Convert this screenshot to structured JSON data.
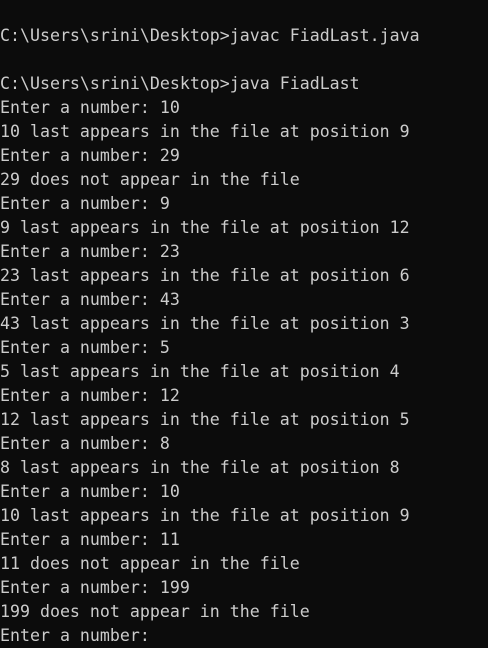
{
  "terminal": {
    "lines": [
      "",
      "C:\\Users\\srini\\Desktop>javac FiadLast.java",
      "",
      "C:\\Users\\srini\\Desktop>java FiadLast",
      "Enter a number: 10",
      "10 last appears in the file at position 9",
      "Enter a number: 29",
      "29 does not appear in the file",
      "Enter a number: 9",
      "9 last appears in the file at position 12",
      "Enter a number: 23",
      "23 last appears in the file at position 6",
      "Enter a number: 43",
      "43 last appears in the file at position 3",
      "Enter a number: 5",
      "5 last appears in the file at position 4",
      "Enter a number: 12",
      "12 last appears in the file at position 5",
      "Enter a number: 8",
      "8 last appears in the file at position 8",
      "Enter a number: 10",
      "10 last appears in the file at position 9",
      "Enter a number: 11",
      "11 does not appear in the file",
      "Enter a number: 199",
      "199 does not appear in the file",
      "Enter a number:"
    ]
  }
}
